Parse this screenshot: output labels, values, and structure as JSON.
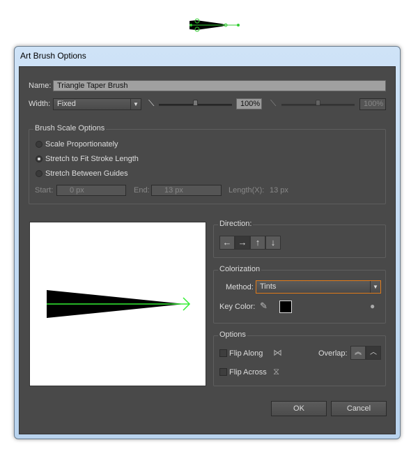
{
  "dialog": {
    "title": "Art Brush Options"
  },
  "name": {
    "label": "Name:",
    "value": "Triangle Taper Brush"
  },
  "width": {
    "label": "Width:",
    "selected": "Fixed",
    "value1": "100%",
    "value2": "100%"
  },
  "brush_scale": {
    "title": "Brush Scale Options",
    "options": [
      {
        "label": "Scale Proportionately",
        "selected": false
      },
      {
        "label": "Stretch to Fit Stroke Length",
        "selected": true
      },
      {
        "label": "Stretch Between Guides",
        "selected": false
      }
    ],
    "start_label": "Start:",
    "start_value": "0 px",
    "end_label": "End:",
    "end_value": "13 px",
    "length_label": "Length(X):",
    "length_value": "13 px"
  },
  "direction": {
    "title": "Direction:",
    "buttons": [
      {
        "icon": "arrow-left-icon",
        "glyph": "←"
      },
      {
        "icon": "arrow-right-icon",
        "glyph": "→",
        "active": true
      },
      {
        "icon": "arrow-up-icon",
        "glyph": "↑"
      },
      {
        "icon": "arrow-down-icon",
        "glyph": "↓"
      }
    ]
  },
  "colorization": {
    "title": "Colorization",
    "method_label": "Method:",
    "method": "Tints",
    "key_color_label": "Key Color:",
    "key_color": "#000000"
  },
  "options": {
    "title": "Options",
    "flip_along": "Flip Along",
    "flip_across": "Flip Across",
    "overlap_label": "Overlap:"
  },
  "buttons": {
    "ok": "OK",
    "cancel": "Cancel"
  },
  "colors": {
    "accent": "#e07b1a",
    "preview_arrow": "#33ee33"
  }
}
